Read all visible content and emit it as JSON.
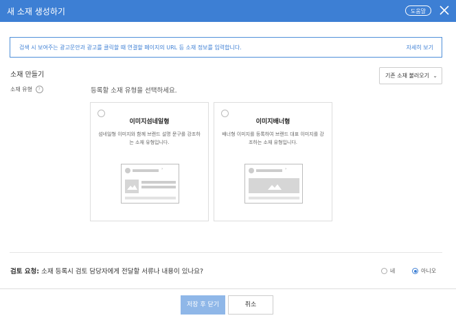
{
  "header": {
    "title": "새 소재 생성하기",
    "help_label": "도움말",
    "accent_color": "#3d7fd4"
  },
  "info": {
    "text": "검색 시 보여주는 광고문안과 광고를 클릭할 때 연결할 페이지의 URL 등 소재 정보를 입력합니다.",
    "more_label": "자세히 보기"
  },
  "section": {
    "title": "소재 만들기",
    "load_label": "기존 소재 불러오기",
    "type_label": "소재 유형",
    "type_prompt": "등록할 소재 유형을 선택하세요."
  },
  "cards": [
    {
      "title": "이미지섬네일형",
      "desc": "섬네일형 이미지와 함께 브랜드 설명 문구를 강조하는 소재 유형입니다."
    },
    {
      "title": "이미지배너형",
      "desc": "배너형 이미지를 등록하여 브랜드 대표 이미지를 강조하는 소재 유형입니다."
    }
  ],
  "review": {
    "label": "검토 요청:",
    "question": " 소재 등록시 검토 담당자에게 전달할 서류나 내용이 있나요?",
    "options": [
      "네",
      "아니오"
    ],
    "selected": "아니오"
  },
  "footer": {
    "save_label": "저장 후 닫기",
    "cancel_label": "취소"
  }
}
